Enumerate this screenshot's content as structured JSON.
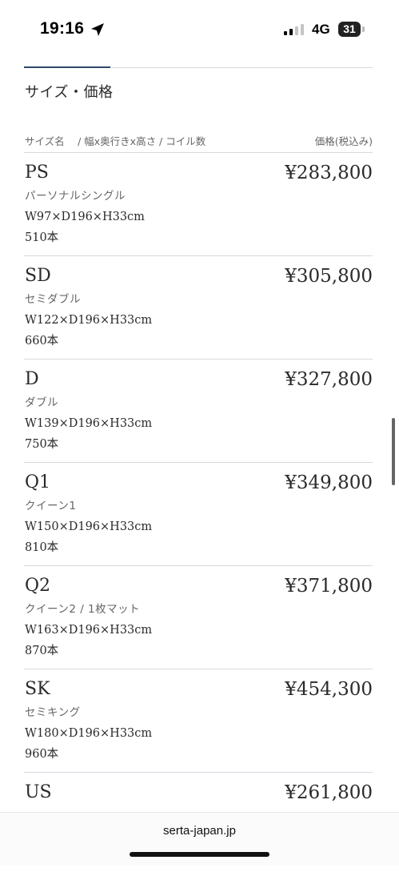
{
  "status_bar": {
    "time": "19:16",
    "network": "4G",
    "battery": "31"
  },
  "section": {
    "title": "サイズ・価格"
  },
  "table_header": {
    "left": "サイズ名　 / 幅x奥行きx高さ / コイル数",
    "right": "価格(税込み)"
  },
  "rows": [
    {
      "code": "PS",
      "name": "パーソナルシングル",
      "dims": "W97×D196×H33cm",
      "coils": "510本",
      "price": "¥283,800"
    },
    {
      "code": "SD",
      "name": "セミダブル",
      "dims": "W122×D196×H33cm",
      "coils": "660本",
      "price": "¥305,800"
    },
    {
      "code": "D",
      "name": "ダブル",
      "dims": "W139×D196×H33cm",
      "coils": "750本",
      "price": "¥327,800"
    },
    {
      "code": "Q1",
      "name": "クイーン1",
      "dims": "W150×D196×H33cm",
      "coils": "810本",
      "price": "¥349,800"
    },
    {
      "code": "Q2",
      "name": "クイーン2 / 1枚マット",
      "dims": "W163×D196×H33cm",
      "coils": "870本",
      "price": "¥371,800"
    },
    {
      "code": "SK",
      "name": "セミキング",
      "dims": "W180×D196×H33cm",
      "coils": "960本",
      "price": "¥454,300"
    },
    {
      "code": "US",
      "name": "",
      "dims": "",
      "coils": "",
      "price": "¥261,800"
    }
  ],
  "browser": {
    "url": "serta-japan.jp"
  },
  "icons": {
    "location": "location-arrow-icon",
    "signal": "cellular-signal-icon",
    "battery": "battery-icon"
  }
}
